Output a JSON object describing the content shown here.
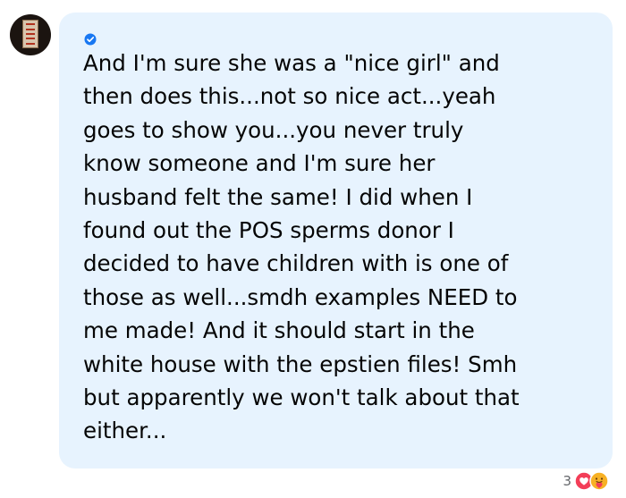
{
  "comment": {
    "text": "And I'm sure she was a \"nice girl\" and\nthen does this...not so nice act...yeah\ngoes to show you...you never truly\nknow someone and I'm sure her\nhusband felt the same! I did when I\nfound out the POS sperms donor I\ndecided to have children with is one of\nthose as well...smdh examples NEED to\nme made! And it should start in the\nwhite house with the epstien files! Smh\nbut apparently we won't talk about that\neither...",
    "verified_icon": "verified-badge-icon",
    "bubble_color": "#e7f3fe",
    "text_color": "#050505"
  },
  "reactions": {
    "count": "3",
    "icons": [
      "love-reaction-icon",
      "care-reaction-icon"
    ]
  }
}
